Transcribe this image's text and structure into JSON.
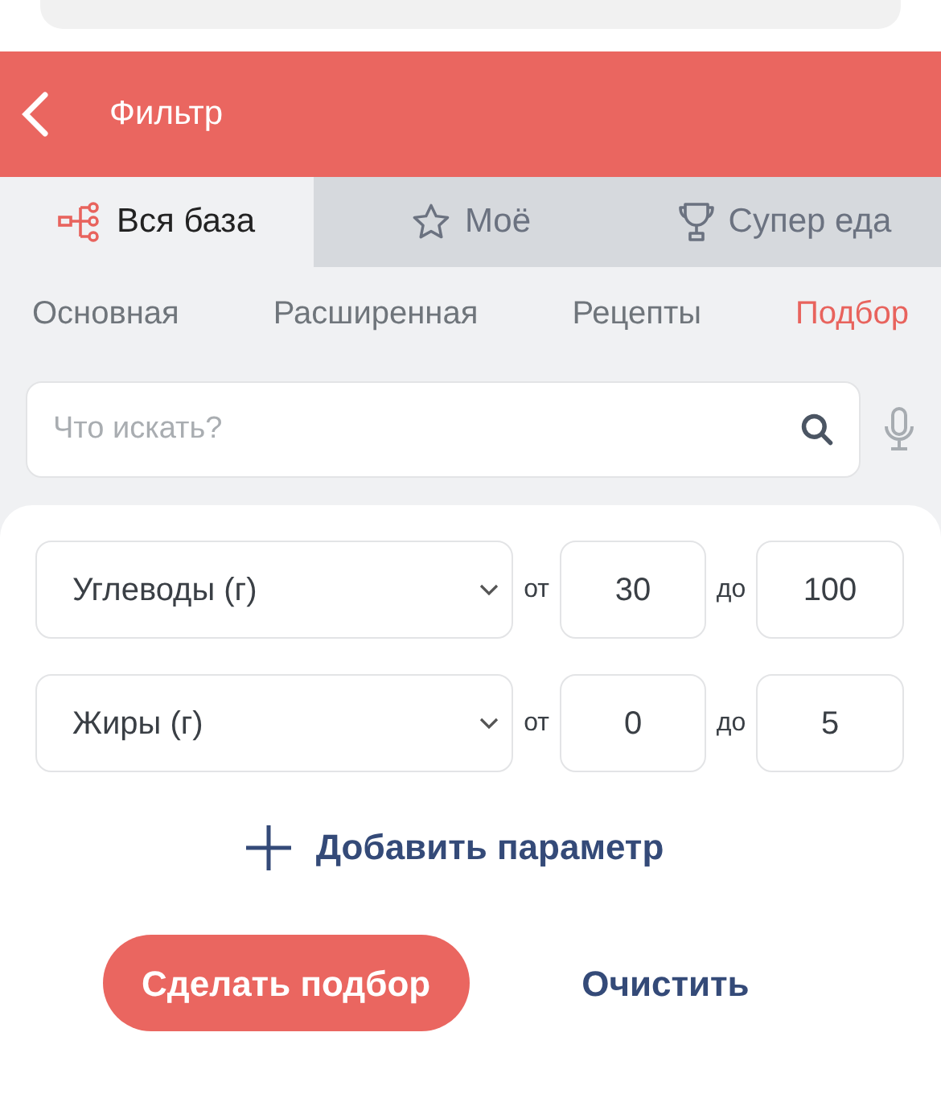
{
  "header": {
    "title": "Фильтр"
  },
  "tabs": [
    {
      "label": "Вся база",
      "kind": "tree",
      "selected": true
    },
    {
      "label": "Моё",
      "kind": "star",
      "selected": false
    },
    {
      "label": "Супер еда",
      "kind": "trophy",
      "selected": false
    }
  ],
  "subtabs": [
    {
      "label": "Основная",
      "selected": false
    },
    {
      "label": "Расширенная",
      "selected": false
    },
    {
      "label": "Рецепты",
      "selected": false
    },
    {
      "label": "Подбор",
      "selected": true
    }
  ],
  "search": {
    "placeholder": "Что искать?"
  },
  "params": [
    {
      "name": "Углеводы (г)",
      "from_label": "от",
      "from": "30",
      "to_label": "до",
      "to": "100"
    },
    {
      "name": "Жиры (г)",
      "from_label": "от",
      "from": "0",
      "to_label": "до",
      "to": "5"
    }
  ],
  "add_button": "Добавить параметр",
  "submit_button": "Сделать подбор",
  "clear_button": "Очистить"
}
